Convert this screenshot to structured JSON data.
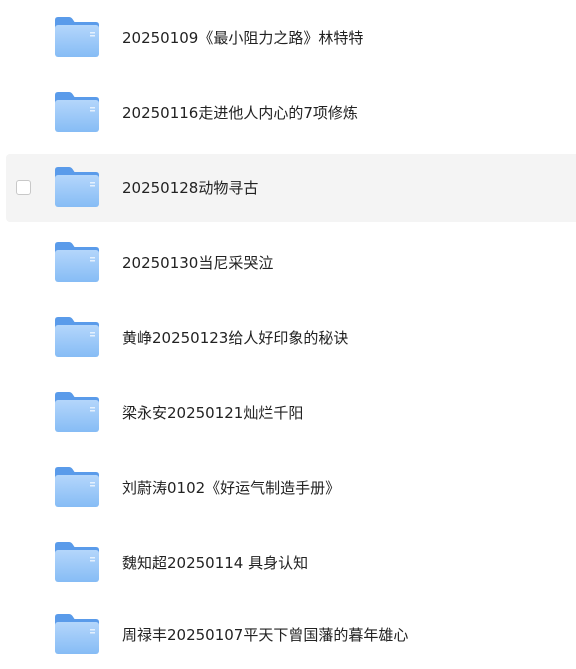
{
  "colors": {
    "folder_back": "#5a9bea",
    "folder_front_top": "#b4d6fb",
    "folder_front_bottom": "#86bcf5",
    "hover_background": "#f4f4f4",
    "text": "#222222"
  },
  "icons": {
    "folder": "folder-icon",
    "checkbox": "checkbox"
  },
  "hovered_index": 2,
  "files": [
    {
      "name": "20250109《最小阻力之路》林特特",
      "type": "folder"
    },
    {
      "name": "20250116走进他人内心的7项修炼",
      "type": "folder"
    },
    {
      "name": "20250128动物寻古",
      "type": "folder"
    },
    {
      "name": "20250130当尼采哭泣",
      "type": "folder"
    },
    {
      "name": "黄峥20250123给人好印象的秘诀",
      "type": "folder"
    },
    {
      "name": "梁永安20250121灿烂千阳",
      "type": "folder"
    },
    {
      "name": "刘蔚涛0102《好运气制造手册》",
      "type": "folder"
    },
    {
      "name": "魏知超20250114 具身认知",
      "type": "folder"
    },
    {
      "name": "周禄丰20250107平天下曾国藩的暮年雄心",
      "type": "folder"
    }
  ]
}
